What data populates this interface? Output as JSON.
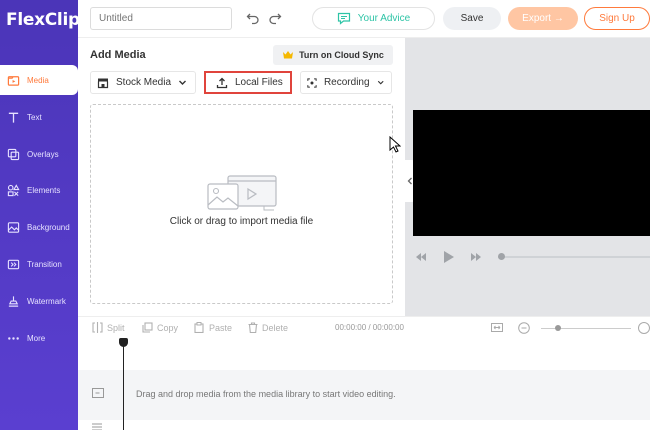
{
  "app": {
    "logo_text": "FlexClip"
  },
  "header": {
    "title_placeholder": "Untitled",
    "advice_label": "Your Advice",
    "save_label": "Save",
    "export_label": "Export →",
    "signup_label": "Sign Up"
  },
  "sidebar": {
    "items": [
      {
        "label": "Media",
        "icon": "media-folder-icon",
        "active": true
      },
      {
        "label": "Text",
        "icon": "text-icon"
      },
      {
        "label": "Overlays",
        "icon": "overlays-icon"
      },
      {
        "label": "Elements",
        "icon": "elements-icon"
      },
      {
        "label": "Background",
        "icon": "background-icon"
      },
      {
        "label": "Transition",
        "icon": "transition-icon"
      },
      {
        "label": "Watermark",
        "icon": "watermark-icon"
      },
      {
        "label": "More",
        "icon": "more-dots-icon"
      }
    ]
  },
  "media_panel": {
    "title": "Add Media",
    "cloud_sync_label": "Turn on Cloud Sync",
    "tabs": [
      {
        "label": "Stock Media"
      },
      {
        "label": "Local Files",
        "highlighted": true
      },
      {
        "label": "Recording"
      }
    ],
    "dropzone_text": "Click or drag to import media file"
  },
  "timeline": {
    "tools": {
      "split": "Split",
      "copy": "Copy",
      "paste": "Paste",
      "delete": "Delete"
    },
    "time_display": "00:00:00 / 00:00:00",
    "hint": "Drag and drop media from the media library to start video editing."
  },
  "colors": {
    "sidebar": "#4b35b8",
    "accent": "#ff7a3c",
    "advice": "#2ec4a6",
    "highlight_border": "#e0443c"
  }
}
